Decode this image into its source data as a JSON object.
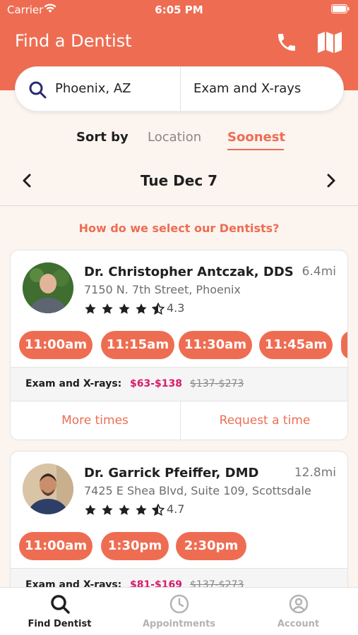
{
  "status_bar": {
    "carrier": "Carrier",
    "time": "6:05 PM"
  },
  "header": {
    "title": "Find a Dentist"
  },
  "search": {
    "location": "Phoenix, AZ",
    "service": "Exam and X-rays"
  },
  "sort": {
    "label": "Sort by",
    "options": [
      "Location",
      "Soonest"
    ],
    "selected": "Soonest"
  },
  "date_nav": {
    "date": "Tue Dec 7"
  },
  "select_info_link": "How do we select our Dentists?",
  "dentists": [
    {
      "name": "Dr. Christopher Antczak, DDS",
      "distance": "6.4mi",
      "address": "7150 N. 7th Street, Phoenix",
      "rating": "4.3",
      "slots": [
        "11:00am",
        "11:15am",
        "11:30am",
        "11:45am"
      ],
      "price_label": "Exam and X-rays:",
      "price": "$63-$138",
      "original_price": "$137-$273",
      "more_times": "More times",
      "request_time": "Request a time"
    },
    {
      "name": "Dr. Garrick Pfeiffer, DMD",
      "distance": "12.8mi",
      "address": "7425 E Shea Blvd, Suite 109, Scottsdale",
      "rating": "4.7",
      "slots": [
        "11:00am",
        "1:30pm",
        "2:30pm"
      ],
      "price_label": "Exam and X-rays:",
      "price": "$81-$169",
      "original_price": "$137-$273"
    }
  ],
  "tabs": [
    {
      "label": "Find Dentist",
      "icon": "search-icon",
      "active": true
    },
    {
      "label": "Appointments",
      "icon": "clock-icon",
      "active": false
    },
    {
      "label": "Account",
      "icon": "account-icon",
      "active": false
    }
  ],
  "colors": {
    "brand": "#ee6d52",
    "price_highlight": "#d81b6a",
    "background": "#fbf4ef"
  }
}
